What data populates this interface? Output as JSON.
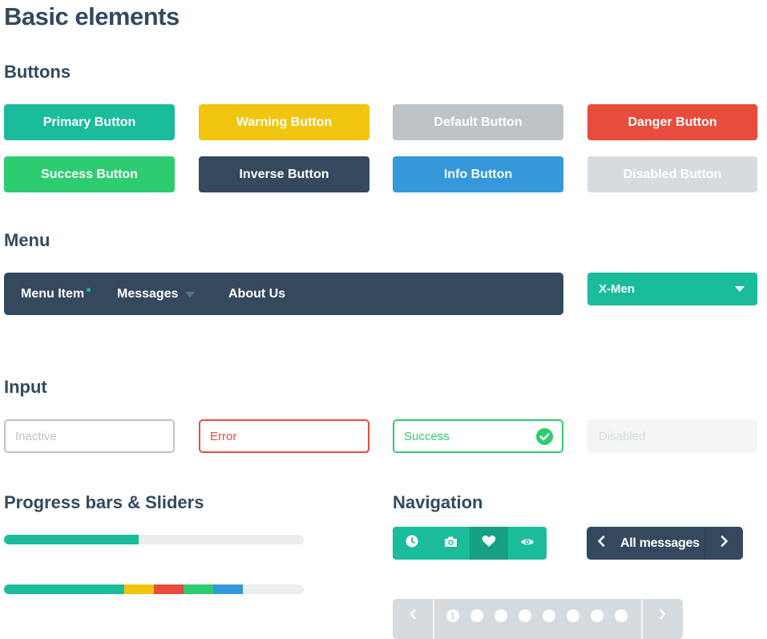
{
  "page": {
    "title": "Basic elements"
  },
  "sections": {
    "buttons": "Buttons",
    "menu": "Menu",
    "input": "Input",
    "progress": "Progress bars & Sliders",
    "navigation": "Navigation"
  },
  "buttons": [
    {
      "label": "Primary Button",
      "color": "#1abc9c"
    },
    {
      "label": "Warning Button",
      "color": "#f1c40f"
    },
    {
      "label": "Default Button",
      "color": "#bdc3c7"
    },
    {
      "label": "Danger Button",
      "color": "#e74c3c"
    },
    {
      "label": "Success Button",
      "color": "#2ecc71"
    },
    {
      "label": "Inverse Button",
      "color": "#34495e"
    },
    {
      "label": "Info Button",
      "color": "#3498db"
    },
    {
      "label": "Disabled Button",
      "color": "#d6dbdf"
    }
  ],
  "menu": {
    "items": [
      {
        "label": "Menu Item",
        "has_badge_dot": true
      },
      {
        "label": "Messages",
        "has_dropdown": true
      },
      {
        "label": "About Us"
      }
    ],
    "select": {
      "value": "X-Men"
    }
  },
  "inputs": [
    {
      "state": "inactive",
      "placeholder": "Inactive",
      "border": "#bdc3c7",
      "text_color": "#bdc3c7"
    },
    {
      "state": "error",
      "placeholder": "Error",
      "border": "#e74c3c",
      "text_color": "#e74c3c"
    },
    {
      "state": "success",
      "placeholder": "Success",
      "border": "#2ecc71",
      "text_color": "#2ecc71",
      "icon": "check-circle-icon"
    },
    {
      "state": "disabled",
      "placeholder": "Disabled",
      "border": "#f4f6f6",
      "text_color": "#d5dbdb"
    }
  ],
  "progress": {
    "bar1": {
      "value": 0.45,
      "color": "#1abc9c"
    },
    "bar2": {
      "segments": [
        {
          "value": 0.4,
          "color": "#1abc9c"
        },
        {
          "value": 0.1,
          "color": "#f1c40f"
        },
        {
          "value": 0.1,
          "color": "#e74c3c"
        },
        {
          "value": 0.1,
          "color": "#2ecc71"
        },
        {
          "value": 0.1,
          "color": "#3498db"
        }
      ]
    }
  },
  "navigation": {
    "icon_tabs": [
      {
        "icon": "clock-icon",
        "active": false
      },
      {
        "icon": "camera-icon",
        "active": false
      },
      {
        "icon": "heart-icon",
        "active": true
      },
      {
        "icon": "eye-icon",
        "active": false
      }
    ],
    "messages_nav": {
      "label": "All messages",
      "prev_icon": "chevron-left-icon",
      "next_icon": "chevron-right-icon"
    },
    "pagination": {
      "current": "1",
      "page_count": 8,
      "prev_icon": "chevron-left-icon",
      "next_icon": "chevron-right-icon"
    }
  }
}
